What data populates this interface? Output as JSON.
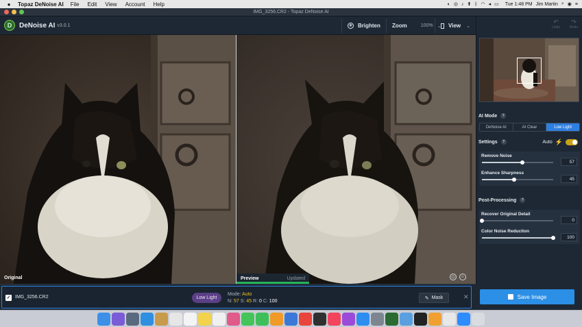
{
  "menubar": {
    "apple": "",
    "app_name": "Topaz DeNoise AI",
    "menus": [
      "File",
      "Edit",
      "View",
      "Account",
      "Help"
    ],
    "clock": "Tue 1:48 PM",
    "user": "Jim Martin"
  },
  "window": {
    "title": "IMG_3256.CR2 - Topaz DeNoise AI"
  },
  "toolbar": {
    "logo_letter": "D",
    "app_name": "DeNoise AI",
    "version": "v3.0.1",
    "brighten_label": "Brighten",
    "zoom_label": "Zoom",
    "zoom_value": "100%",
    "view_label": "View"
  },
  "panes": {
    "original_label": "Original",
    "preview_label": "Preview",
    "preview_status": "Updated",
    "preview_progress": 1.0
  },
  "filmstrip": {
    "filename": "IMG_3256.CR2",
    "mode_pill": "Low Light",
    "mode_label": "Mode:",
    "mode_value": "Auto",
    "n_label": "N:",
    "n_value": "57",
    "s_label": "S:",
    "s_value": "45",
    "r_label": "R:",
    "r_value": "0",
    "c_label": "C:",
    "c_value": "100",
    "mask_label": "Mask"
  },
  "panel": {
    "undo_label": "Undo",
    "redo_label": "Redo",
    "ai_mode_title": "AI Mode",
    "mode_tabs": [
      "DeNoise AI",
      "AI Clear",
      "Low Light"
    ],
    "active_mode": "Low Light",
    "settings_title": "Settings",
    "auto_label": "Auto",
    "auto_on": true,
    "sliders": [
      {
        "label": "Remove Noise",
        "value": "57",
        "fraction": 0.57
      },
      {
        "label": "Enhance Sharpness",
        "value": "45",
        "fraction": 0.45
      }
    ],
    "post_title": "Post-Processing",
    "post_sliders": [
      {
        "label": "Recover Original Detail",
        "value": "0",
        "fraction": 0.0
      },
      {
        "label": "Color Noise Reduction",
        "value": "100",
        "fraction": 1.0
      }
    ],
    "save_label": "Save Image"
  },
  "colors": {
    "accent_blue": "#2f7fe0",
    "save_blue": "#2b8fe6",
    "auto_yellow": "#f2c11a",
    "progress_green": "#26b358",
    "pill_purple": "#5b3f86"
  },
  "dock_icons": [
    "finder-icon",
    "siri-icon",
    "launchpad-icon",
    "safari-icon",
    "notes-icon",
    "photos-icon",
    "calendar-icon",
    "stickies-icon",
    "reminders-icon",
    "photos-app-icon",
    "messages-icon",
    "facetime-icon",
    "pages-icon",
    "keynote-icon",
    "news-icon",
    "stocks-icon",
    "music-icon",
    "podcasts-icon",
    "appstore-icon",
    "settings-icon",
    "topaz-icon",
    "preview-icon",
    "terminal-icon",
    "books-icon",
    "chrome-icon",
    "zoom-icon",
    "trash-icon"
  ]
}
